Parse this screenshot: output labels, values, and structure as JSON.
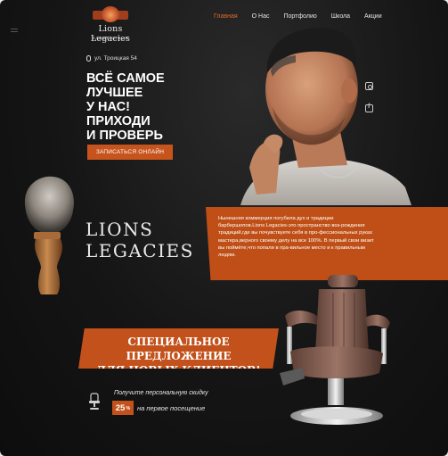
{
  "brand_logo": {
    "line1": "Lions Legacies",
    "line2": "BARBERSHOP"
  },
  "nav": [
    {
      "label": "Главная",
      "active": true
    },
    {
      "label": "О Нас"
    },
    {
      "label": "Портфолио"
    },
    {
      "label": "Школа"
    },
    {
      "label": "Акции"
    }
  ],
  "address": "ул. Троицкая 54",
  "hero": {
    "title": "ВСЁ САМОЕ ЛУЧШЕЕ\nУ НАС!\nПРИХОДИ\nИ ПРОВЕРЬ",
    "cta_label": "ЗАПИСАТЬСЯ ОНЛАЙН"
  },
  "social": [
    {
      "icon": "instagram-icon"
    },
    {
      "icon": "facebook-icon"
    }
  ],
  "brand_title": "LIONS\nLEGACIES",
  "about_text": "Нынешняя коммерция погубила дух и традиции барбершопов.Lions Legacies-это пространство воз-рождения традиций,где вы почувствуете себя в про-фессиональных руках мастера,верного своему делу на все 100%.\nВ первый свои визит вы поймёте,что попали в пра-вильное место и к правильным людям.",
  "offer": {
    "title": "СПЕЦИАЛЬНОЕ ПРЕДЛОЖЕНИЕ\nДЛЯ НОВЫХ КЛИЕНТОВ!",
    "line1": "Получите персональную скидку",
    "percent": "25",
    "percent_sign": "%",
    "line2": "на первое посещение"
  },
  "colors": {
    "accent": "#c7541d",
    "background": "#151515"
  }
}
